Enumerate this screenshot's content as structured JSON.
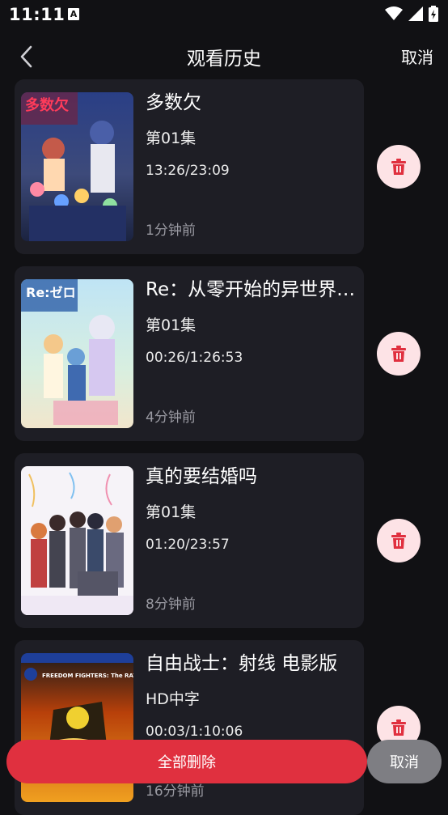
{
  "status_bar": {
    "time": "11:11",
    "notification_letter": "A"
  },
  "header": {
    "title": "观看历史",
    "cancel_label": "取消"
  },
  "items": [
    {
      "title": "多数欠",
      "episode": "第01集",
      "progress": "13:26/23:09",
      "watched_ago": "1分钟前",
      "poster_caption": "多数欠"
    },
    {
      "title": "Re：从零开始的异世界生活",
      "episode": "第01集",
      "progress": "00:26/1:26:53",
      "watched_ago": "4分钟前",
      "poster_caption": "Re:ゼロ"
    },
    {
      "title": "真的要结婚吗",
      "episode": "第01集",
      "progress": "01:20/23:57",
      "watched_ago": "8分钟前",
      "poster_caption": ""
    },
    {
      "title": "自由战士：射线 电影版",
      "episode": "HD中字",
      "progress": "00:03/1:10:06",
      "watched_ago": "16分钟前",
      "poster_caption": "FREEDOM FIGHTERS: The RAY"
    }
  ],
  "bottom": {
    "delete_all_label": "全部删除",
    "cancel_label": "取消"
  },
  "colors": {
    "background": "#111114",
    "card": "#1e1e25",
    "danger": "#e0303f",
    "delete_icon_bg": "#fde3e6"
  }
}
